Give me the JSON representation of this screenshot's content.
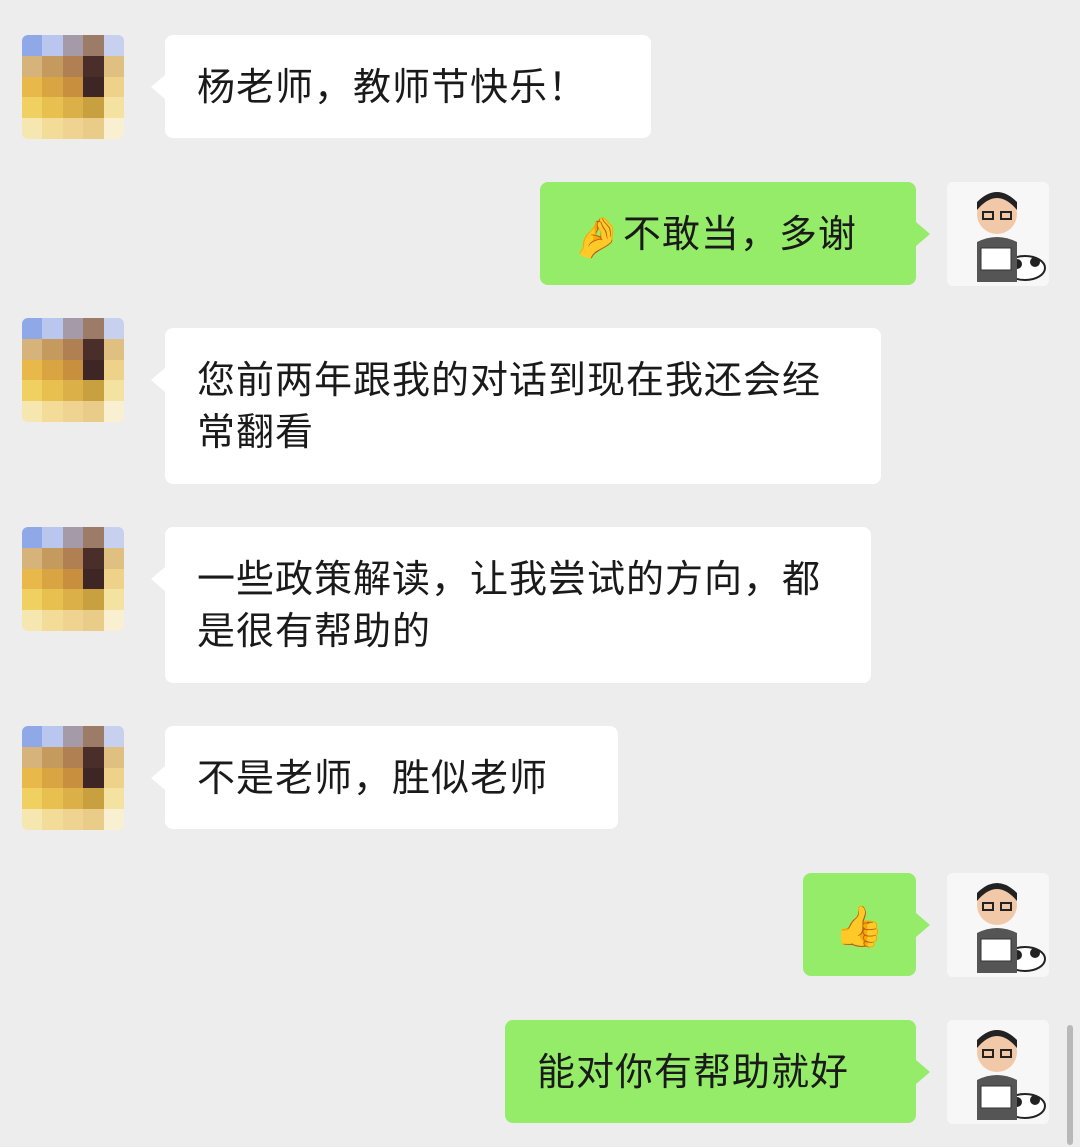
{
  "colors": {
    "background": "#ededed",
    "incoming_bubble": "#ffffff",
    "outgoing_bubble": "#95ec69"
  },
  "messages": [
    {
      "side": "incoming",
      "text": "杨老师，教师节快乐！"
    },
    {
      "side": "outgoing",
      "emoji": "🤌",
      "text": "不敢当，多谢"
    },
    {
      "side": "incoming",
      "text": "您前两年跟我的对话到现在我还会经常翻看"
    },
    {
      "side": "incoming",
      "text": "一些政策解读，让我尝试的方向，都是很有帮助的"
    },
    {
      "side": "incoming",
      "text": "不是老师，胜似老师"
    },
    {
      "side": "outgoing",
      "emoji": "👍"
    },
    {
      "side": "outgoing",
      "text": "能对你有帮助就好"
    }
  ],
  "avatars": {
    "incoming": "blurred-contact-avatar",
    "outgoing": "cartoon-man-with-panda-avatar"
  }
}
